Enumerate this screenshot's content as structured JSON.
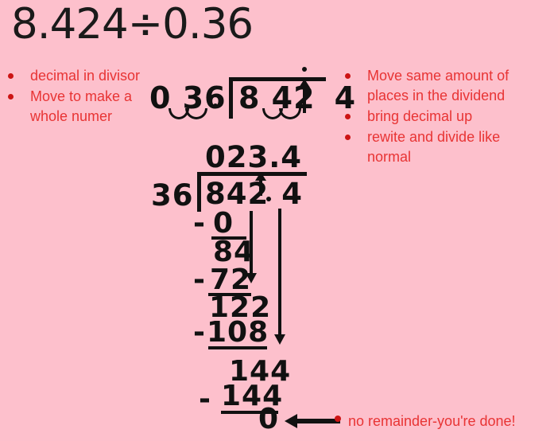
{
  "slide": {
    "background_color": "#fdc0cc",
    "accent_red": "#e83434",
    "ink_black": "#111111",
    "title": "8.424÷0.36"
  },
  "left_bullets": {
    "items": [
      {
        "label": "decimal in divisor"
      },
      {
        "label": "Move to make a whole numer"
      }
    ]
  },
  "right_bullets": {
    "items": [
      {
        "label": "Move same amount of places in the dividend"
      },
      {
        "label": "bring decimal up"
      },
      {
        "label": "rewite and divide like normal"
      }
    ]
  },
  "setup_division": {
    "divisor": "0 36",
    "divisor_decimal_mark": ".",
    "dividend": "8 42",
    "dividend_tail": "4",
    "hops": 2,
    "note": "decimal moved two places right in divisor and dividend"
  },
  "long_division": {
    "quotient": "023.4",
    "divisor": "36",
    "dividend": "842",
    "dividend_tail": "4",
    "steps": [
      {
        "minus": "-",
        "value": "0"
      },
      {
        "minus": "",
        "value": "84"
      },
      {
        "minus": "-",
        "value": "72"
      },
      {
        "minus": "",
        "value": "122"
      },
      {
        "minus": "-",
        "value": "108"
      },
      {
        "minus": "",
        "value": "144"
      },
      {
        "minus": "-",
        "value": "144"
      },
      {
        "minus": "",
        "value": "0"
      }
    ]
  },
  "annotation": {
    "final_note": "no remainder-you're done!"
  }
}
